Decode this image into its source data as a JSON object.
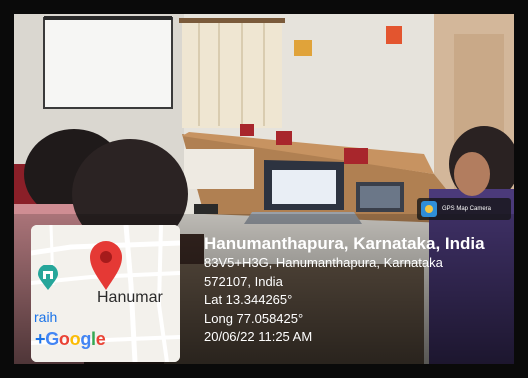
{
  "app": {
    "badge_label": "GPS Map Camera",
    "badge_icon": "gps-map-camera-icon"
  },
  "map": {
    "place_label": "Hanumar",
    "left_label": "raih",
    "logo": {
      "plus": "+",
      "G": "G",
      "o1": "o",
      "o2": "o",
      "g": "g",
      "l": "l",
      "e": "e"
    },
    "pin_icon": "map-pin-icon",
    "poi_icon": "landmark-icon",
    "colors": {
      "pin": "#e53935",
      "poi": "#26a69a",
      "road": "#ffffff",
      "land": "#f3f1ec"
    }
  },
  "location": {
    "title": "Hanumanthapura, Karnataka, India",
    "address_line1": "83V5+H3G, Hanumanthapura, Karnataka",
    "address_line2": "572107, India",
    "lat": "Lat 13.344265°",
    "long": "Long 77.058425°",
    "datetime": "20/06/22 11:25 AM"
  }
}
